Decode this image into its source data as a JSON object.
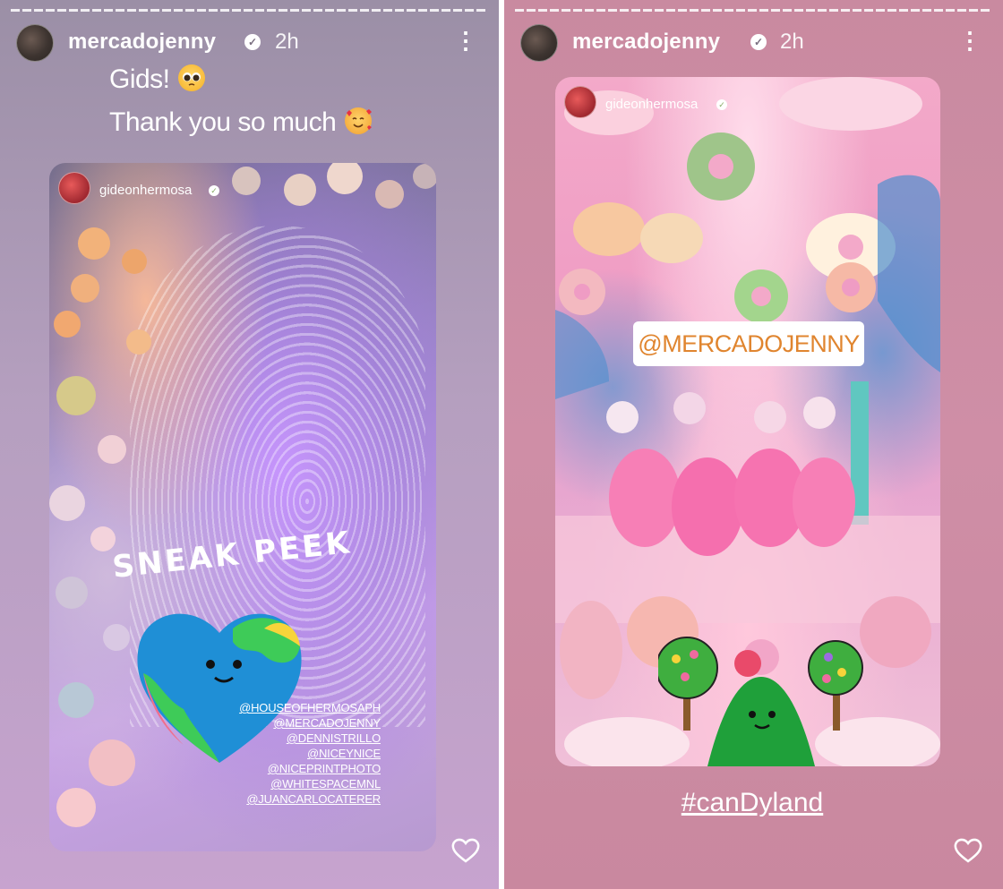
{
  "stories": [
    {
      "username": "mercadojenny",
      "time": "2h",
      "caption_lines": [
        "Gids!",
        "Thank you so much"
      ],
      "card": {
        "username": "gideonhermosa",
        "sticker_text": "SNEAK PEEK",
        "mentions": [
          "@HOUSEOFHERMOSAPH",
          "@MERCADOJENNY",
          "@DENNISTRILLO",
          "@NICEYNICE",
          "@NICEPRINTPHOTO",
          "@WHITESPACEMNL",
          "@JUANCARLOCATERER"
        ]
      }
    },
    {
      "username": "mercadojenny",
      "time": "2h",
      "card": {
        "username": "gideonhermosa",
        "mention_sticker": "@MERCADOJENNY"
      },
      "hashtag": "#canDyland"
    }
  ]
}
